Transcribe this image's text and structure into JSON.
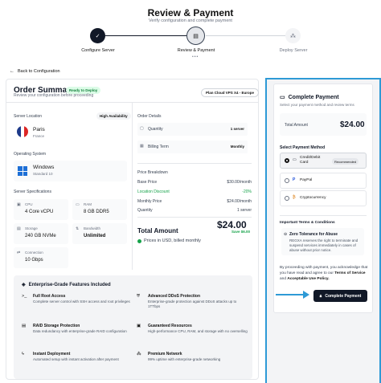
{
  "header": {
    "title": "Review & Payment",
    "subtitle": "Verify configuration and complete payment"
  },
  "steps": [
    {
      "label": "Configure Server",
      "state": "done"
    },
    {
      "label": "Review & Payment",
      "state": "active"
    },
    {
      "label": "Deploy Server",
      "state": "todo"
    }
  ],
  "back_link": "Back to Configuration",
  "summary": {
    "title": "Order Summary",
    "badge": "Ready to Deploy",
    "subtitle": "Review your configuration before proceeding",
    "plan": "Plan Cloud VPS X4 - Europe",
    "location_label": "Server Location",
    "location_badge": "High Availability",
    "country": "Paris",
    "region": "France",
    "os_label": "Operating System",
    "os_name": "Windows",
    "os_version": "Standard 10",
    "specs_label": "Server Specifications",
    "specs": [
      {
        "title": "CPU",
        "value": "4 Core vCPU",
        "icon": "cpu-icon",
        "bold": false
      },
      {
        "title": "RAM",
        "value": "8 GB DDR5",
        "icon": "ram-icon",
        "bold": false
      },
      {
        "title": "Storage",
        "value": "240 GB NVMe",
        "icon": "storage-icon",
        "bold": false
      },
      {
        "title": "Bandwidth",
        "value": "Unlimited",
        "icon": "bandwidth-icon",
        "bold": true
      },
      {
        "title": "Connection",
        "value": "10 Gbps",
        "icon": "connection-icon",
        "bold": false
      }
    ]
  },
  "order_details": {
    "title": "Order Details",
    "quantity_label": "Quantity",
    "quantity_value": "1 server",
    "billing_label": "Billing Term",
    "billing_value": "Monthly"
  },
  "price_breakdown": {
    "title": "Price Breakdown",
    "rows": [
      {
        "label": "Base Price",
        "value": "$30.00/month"
      },
      {
        "label": "Location Discount",
        "value": "-20%"
      },
      {
        "label": "Monthly Price",
        "value": "$24.00/month"
      },
      {
        "label": "Quantity",
        "value": "1 server"
      }
    ],
    "total_label": "Total Amount",
    "total_value": "$24.00",
    "save_text": "Save $6.00",
    "currency_note": "Prices in USD, billed monthly"
  },
  "enterprise": {
    "title": "Enterprise-Grade Features Included",
    "features": [
      {
        "title": "Full Root Access",
        "desc": "Complete server control with SSH access and root privileges",
        "icon": "terminal-icon"
      },
      {
        "title": "Advanced DDoS Protection",
        "desc": "Enterprise-grade protection against DDoS attacks up to 1TTbps",
        "icon": "shield-icon"
      },
      {
        "title": "RAID Storage Protection",
        "desc": "Data redundancy with enterprise-grade RAID configuration",
        "icon": "raid-icon"
      },
      {
        "title": "Guaranteed Resources",
        "desc": "High-performance CPU, RAM, and storage with no overselling",
        "icon": "resources-icon"
      },
      {
        "title": "Instant Deployment",
        "desc": "Automated setup with instant activation after payment",
        "icon": "bolt-icon"
      },
      {
        "title": "Premium Network",
        "desc": "99% uptime with enterprise-grade networking",
        "icon": "network-icon"
      }
    ]
  },
  "payment": {
    "title": "Complete Payment",
    "subtitle": "Select your payment method and review terms",
    "total_label": "Total Amount",
    "total_value": "$24.00",
    "method_label": "Select Payment Method",
    "methods": [
      {
        "label": "Credit/Debit Card",
        "selected": true,
        "badge": "Recommended"
      },
      {
        "label": "PayPal",
        "selected": false,
        "badge": ""
      },
      {
        "label": "Cryptocurrency",
        "selected": false,
        "badge": ""
      }
    ],
    "terms_title": "Important Terms & Conditions",
    "zt_title": "Zero Tolerance for Abuse",
    "zt_desc": "REGXA reserves the right to terminate and suspend services immediately in cases of abuse without prior notice.",
    "proceed_pre": "By proceeding with payment, you acknowledge that you have read and agree to our",
    "terms_link": "Terms of Service",
    "and_text": "and",
    "aup_link": "Acceptable Use Policy.",
    "button": "Complete Payment"
  },
  "colors": {
    "accent": "#2e9ad6",
    "dark": "#111827",
    "green": "#16a34a"
  }
}
